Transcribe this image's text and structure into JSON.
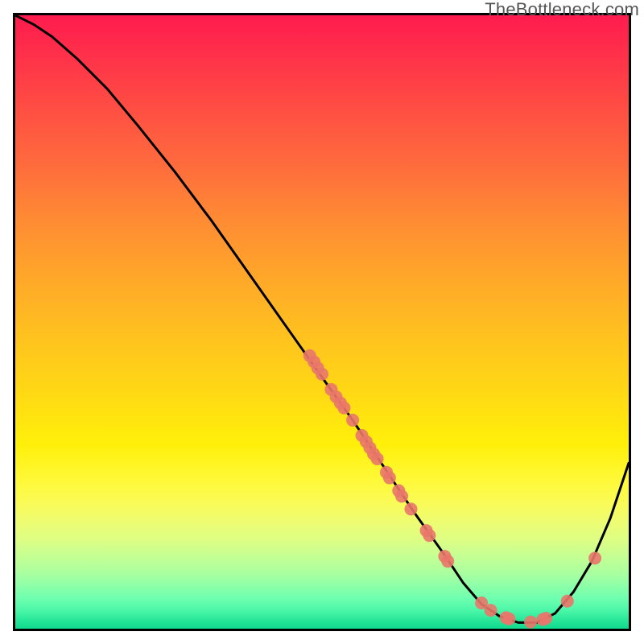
{
  "watermark": "TheBottleneck.com",
  "chart_data": {
    "type": "line",
    "title": "",
    "xlabel": "",
    "ylabel": "",
    "xlim": [
      0,
      100
    ],
    "ylim": [
      0,
      100
    ],
    "grid": false,
    "legend": "none",
    "series": [
      {
        "name": "bottleneck-curve",
        "x": [
          0,
          3,
          6,
          10,
          15,
          20,
          26,
          32,
          38,
          44,
          50,
          55,
          60,
          65,
          70,
          73,
          76,
          79,
          82,
          85,
          88,
          91,
          94,
          97,
          100
        ],
        "values": [
          100,
          98.5,
          96.5,
          93,
          88,
          82,
          74.5,
          66.5,
          58,
          49.5,
          41,
          34,
          26.5,
          19,
          12,
          7.5,
          4,
          2,
          1,
          1,
          2.5,
          6,
          11,
          18,
          27
        ]
      }
    ],
    "scatter_points": {
      "name": "highlighted-points",
      "coords": [
        {
          "x": 48,
          "y": 44.5
        },
        {
          "x": 48.7,
          "y": 43.5
        },
        {
          "x": 49.3,
          "y": 42.5
        },
        {
          "x": 50,
          "y": 41.5
        },
        {
          "x": 51.5,
          "y": 39
        },
        {
          "x": 52.3,
          "y": 37.8
        },
        {
          "x": 53,
          "y": 36.8
        },
        {
          "x": 53.6,
          "y": 36
        },
        {
          "x": 55,
          "y": 34
        },
        {
          "x": 56.5,
          "y": 31.5
        },
        {
          "x": 57.2,
          "y": 30.5
        },
        {
          "x": 57.8,
          "y": 29.5
        },
        {
          "x": 58.4,
          "y": 28.5
        },
        {
          "x": 59,
          "y": 27.7
        },
        {
          "x": 60.5,
          "y": 25.5
        },
        {
          "x": 61,
          "y": 24.6
        },
        {
          "x": 62.5,
          "y": 22.5
        },
        {
          "x": 63,
          "y": 21.6
        },
        {
          "x": 64.5,
          "y": 19.5
        },
        {
          "x": 67,
          "y": 16
        },
        {
          "x": 67.5,
          "y": 15.2
        },
        {
          "x": 70,
          "y": 11.8
        },
        {
          "x": 70.5,
          "y": 11
        },
        {
          "x": 76,
          "y": 4.2
        },
        {
          "x": 77.5,
          "y": 3
        },
        {
          "x": 80,
          "y": 1.8
        },
        {
          "x": 80.5,
          "y": 1.6
        },
        {
          "x": 84,
          "y": 1.1
        },
        {
          "x": 86,
          "y": 1.5
        },
        {
          "x": 86.5,
          "y": 1.7
        },
        {
          "x": 90,
          "y": 4.5
        },
        {
          "x": 94.5,
          "y": 11.5
        }
      ],
      "radius": 8,
      "color": "#e9776a"
    },
    "colors": {
      "curve": "#000000",
      "gradient_top": "#ff1b4e",
      "gradient_bottom": "#0fd98e"
    }
  }
}
